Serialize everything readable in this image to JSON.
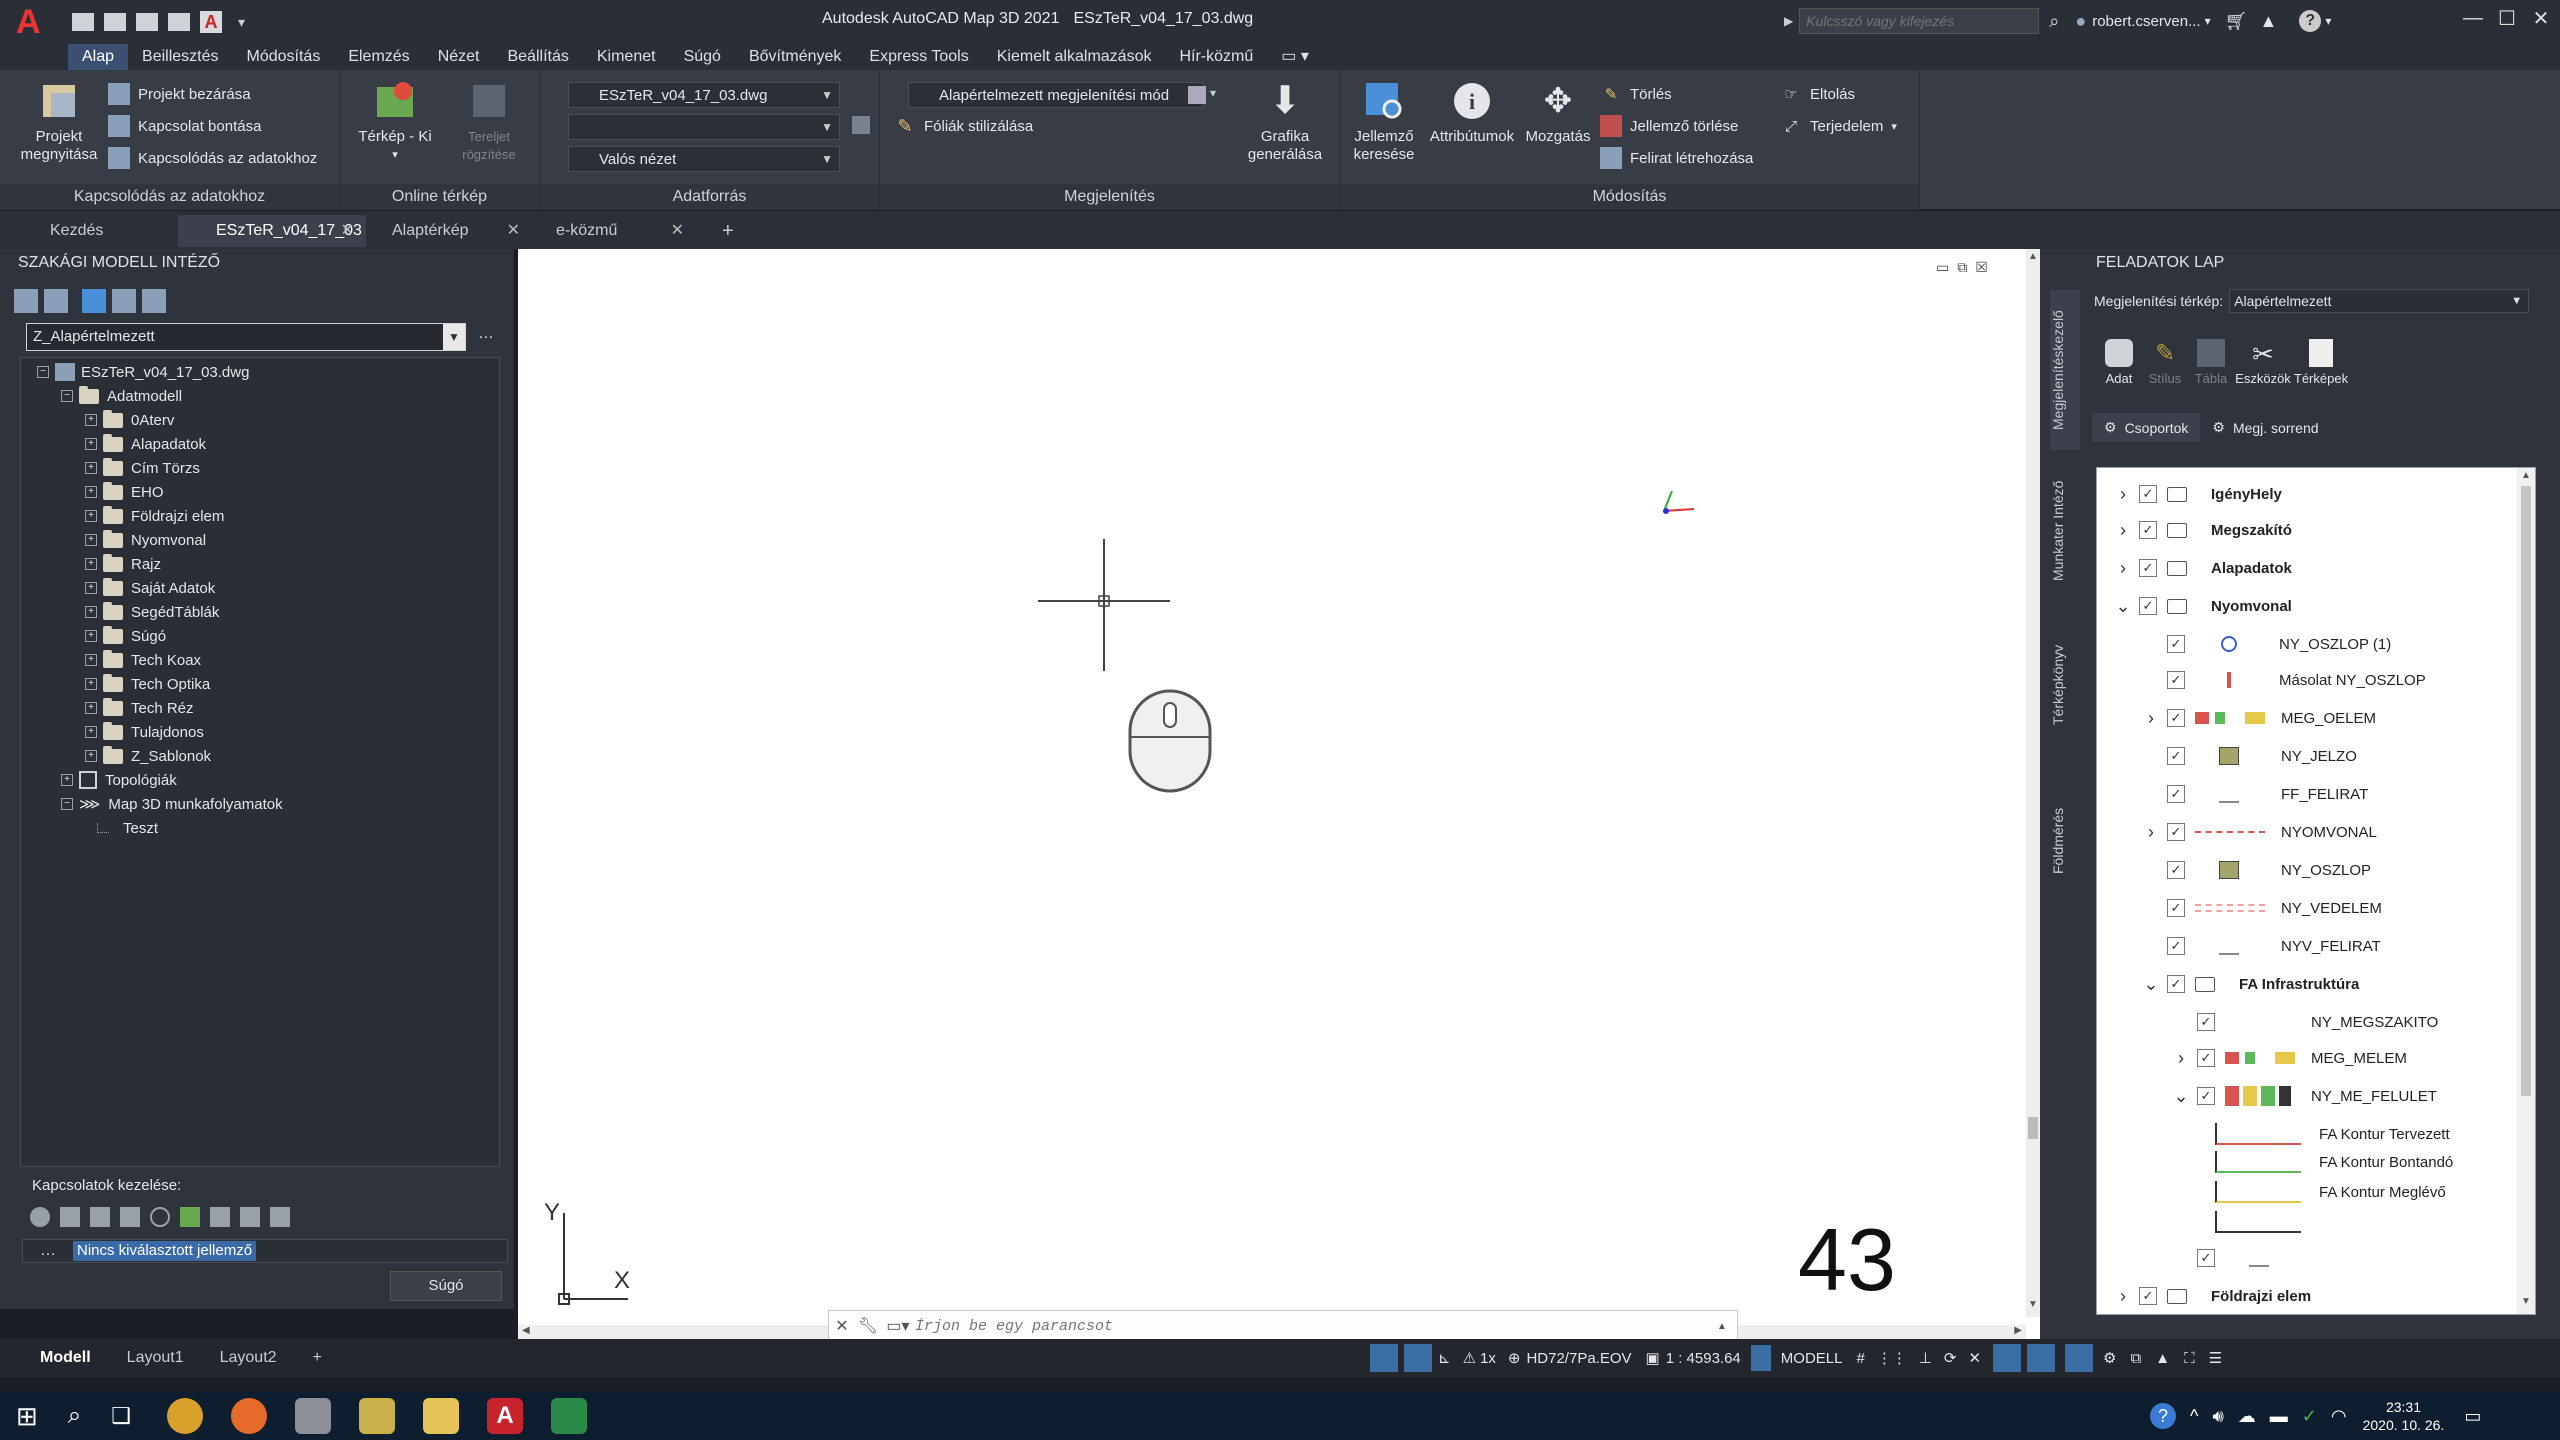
{
  "window": {
    "title": "Autodesk AutoCAD Map 3D 2021",
    "filename": "ESzTeR_v04_17_03.dwg",
    "search_placeholder": "Kulcsszó vagy kifejezés",
    "user": "robert.cserven..."
  },
  "menu": [
    "Alap",
    "Beillesztés",
    "Módosítás",
    "Elemzés",
    "Nézet",
    "Beállítás",
    "Kimenet",
    "Súgó",
    "Bővítmények",
    "Express Tools",
    "Kiemelt alkalmazások",
    "Hír-közmű"
  ],
  "ribbon": {
    "panel1": {
      "title": "Kapcsolódás az adatokhoz",
      "big": "Projekt megnyitása",
      "items": [
        "Projekt bezárása",
        "Kapcsolat bontása",
        "Kapcsolódás az adatokhoz"
      ]
    },
    "panel2": {
      "title": "Online térkép",
      "big1": "Térkép - Ki",
      "big2": "Tereljet rögzítése"
    },
    "panel3": {
      "title": "Adatforrás",
      "combo1": "ESzTeR_v04_17_03.dwg",
      "combo2": "",
      "combo3": "Valós nézet"
    },
    "panel4": {
      "title": "Megjelenítés",
      "combo": "Alapértelmezett megjelenítési mód",
      "item": "Fóliák stilizálása",
      "big": "Grafika generálása"
    },
    "panel5": {
      "title": "Módosítás",
      "big1": "Jellemző keresése",
      "big2": "Attribútumok",
      "big3": "Mozgatás",
      "items": [
        "Törlés",
        "Jellemző törlése",
        "Felirat létrehozása"
      ],
      "items2": [
        "Eltolás",
        "Terjedelem"
      ]
    }
  },
  "doc_tabs": [
    "Kezdés",
    "ESzTeR_v04_17_03",
    "Alaptérkép",
    "e-közmű"
  ],
  "left_panel": {
    "title": "SZAKÁGI MODELL INTÉZŐ",
    "selector": "Z_Alapértelmezett",
    "tree_root": "ESzTeR_v04_17_03.dwg",
    "tree_model": "Adatmodell",
    "tree_items": [
      "0Aterv",
      "Alapadatok",
      "Cím Törzs",
      "EHO",
      "Földrajzi elem",
      "Nyomvonal",
      "Rajz",
      "Saját Adatok",
      "SegédTáblák",
      "Súgó",
      "Tech Koax",
      "Tech Optika",
      "Tech Réz",
      "Tulajdonos",
      "Z_Sablonok"
    ],
    "topology": "Topológiák",
    "workflows": "Map 3D munkafolyamatok",
    "test": "Teszt",
    "connections_label": "Kapcsolatok kezelése:",
    "no_selection": "Nincs kiválasztott jellemző",
    "help_button": "Súgó"
  },
  "canvas": {
    "axis_y": "Y",
    "axis_x": "X",
    "command_placeholder": "Írjon be egy parancsot",
    "overlay_number": "43"
  },
  "right_panel": {
    "title": "FELADATOK LAP",
    "map_label": "Megjelenítési térkép:",
    "map_value": "Alapértelmezett",
    "tools": [
      "Adat",
      "Stílus",
      "Tábla",
      "Eszközök",
      "Térképek"
    ],
    "tabs": [
      "Csoportok",
      "Megj. sorrend"
    ],
    "vertical_tabs": [
      "Megjelenítéskezelő",
      "Munkater Intéző",
      "Térképkönyv",
      "Földmérés"
    ],
    "layers": [
      {
        "name": "IgényHely",
        "level": 0,
        "type": "group",
        "expand": "collapsed"
      },
      {
        "name": "Megszakító",
        "level": 0,
        "type": "group",
        "expand": "collapsed"
      },
      {
        "name": "Alapadatok",
        "level": 0,
        "type": "group",
        "expand": "collapsed"
      },
      {
        "name": "Nyomvonal",
        "level": 0,
        "type": "group",
        "expand": "expanded"
      },
      {
        "name": "NY_OSZLOP (1)",
        "level": 1,
        "type": "layer",
        "swatch": "circle-blue"
      },
      {
        "name": "Másolat NY_OSZLOP",
        "level": 1,
        "type": "layer",
        "swatch": "red-mark"
      },
      {
        "name": "MEG_OELEM",
        "level": 1,
        "type": "layer",
        "expand": "collapsed",
        "swatch": "multi"
      },
      {
        "name": "NY_JELZO",
        "level": 1,
        "type": "layer",
        "swatch": "olive-square"
      },
      {
        "name": "FF_FELIRAT",
        "level": 1,
        "type": "layer",
        "swatch": "label"
      },
      {
        "name": "NYOMVONAL",
        "level": 1,
        "type": "layer",
        "expand": "collapsed",
        "swatch": "red-line"
      },
      {
        "name": "NY_OSZLOP",
        "level": 1,
        "type": "layer",
        "swatch": "olive-square"
      },
      {
        "name": "NY_VEDELEM",
        "level": 1,
        "type": "layer",
        "swatch": "dashed-red"
      },
      {
        "name": "NYV_FELIRAT",
        "level": 1,
        "type": "layer",
        "swatch": "label"
      },
      {
        "name": "FA Infrastruktúra",
        "level": 1,
        "type": "group",
        "expand": "expanded"
      },
      {
        "name": "NY_MEGSZAKITO",
        "level": 2,
        "type": "layer",
        "swatch": "none"
      },
      {
        "name": "MEG_MELEM",
        "level": 2,
        "type": "layer",
        "expand": "collapsed",
        "swatch": "multi"
      },
      {
        "name": "NY_ME_FELULET",
        "level": 2,
        "type": "layer",
        "expand": "expanded",
        "swatch": "boxes"
      },
      {
        "name": "FA Kontur Tervezett",
        "level": 3,
        "type": "theme",
        "swatch": "red"
      },
      {
        "name": "FA Kontur Bontandó",
        "level": 3,
        "type": "theme",
        "swatch": "green"
      },
      {
        "name": "FA Kontur Meglévő",
        "level": 3,
        "type": "theme",
        "swatch": "yellow"
      },
      {
        "name": "",
        "level": 3,
        "type": "theme",
        "swatch": "dark"
      },
      {
        "name": "",
        "level": 2,
        "type": "layer",
        "swatch": "label"
      },
      {
        "name": "Földrajzi elem",
        "level": 0,
        "type": "group",
        "expand": "collapsed"
      }
    ]
  },
  "status": {
    "layout_tabs": [
      "Modell",
      "Layout1",
      "Layout2"
    ],
    "scale_factor": "1x",
    "coordinate_system": "HD72/7Pa.EOV",
    "scale": "1 : 4593.64",
    "space": "MODELL",
    "clock_time": "23:31",
    "clock_date": "2020. 10. 26."
  },
  "colors": {
    "accent": "#3b5070",
    "canvas": "#ffffff",
    "panel": "#2f333b"
  }
}
